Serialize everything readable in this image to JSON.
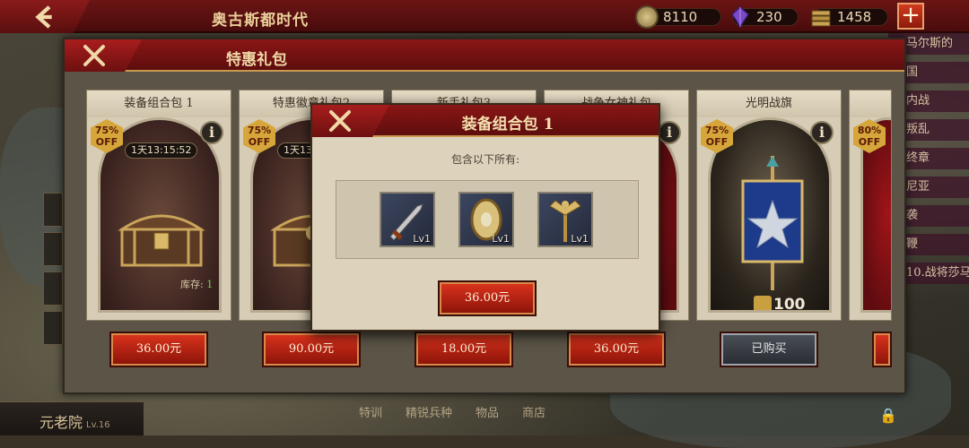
{
  "topbar": {
    "title": "奥古斯都时代",
    "resources": [
      {
        "icon": "coin-icon",
        "value": "8110"
      },
      {
        "icon": "gem-icon",
        "value": "230"
      },
      {
        "icon": "wood-icon",
        "value": "1458"
      }
    ],
    "plus_label": "+"
  },
  "side_list": [
    "马尔斯的",
    "国",
    "内战",
    "叛乱",
    "终章",
    "尼亚",
    "袭",
    "鞭",
    "10.战将莎马人"
  ],
  "bottom": {
    "senate_label": "元老院",
    "senate_level": "Lv.16",
    "tabs": [
      "特训",
      "精锐兵种",
      "物品",
      "商店"
    ]
  },
  "panel": {
    "title": "特惠礼包",
    "cards": [
      {
        "title": "装备组合包 1",
        "off": "75%\nOFF",
        "timer": "1天13:15:52",
        "stock_label": "库存:",
        "stock_value": "1",
        "price": "36.00元"
      },
      {
        "title": "特惠徽章礼包2",
        "off": "75%\nOFF",
        "timer": "1天13:15:52",
        "price": "90.00元"
      },
      {
        "title": "新手礼包3",
        "price": "18.00元"
      },
      {
        "title": "战争女神礼包",
        "price": "36.00元"
      },
      {
        "title": "光明战旗",
        "off": "75%\nOFF",
        "quantity": "100",
        "price": "已购买"
      },
      {
        "title": "",
        "off": "80%\nOFF",
        "price": ""
      }
    ]
  },
  "modal": {
    "title": "装备组合包 1",
    "subtitle": "包含以下所有:",
    "items": [
      {
        "icon": "dagger-icon",
        "level": "Lv1"
      },
      {
        "icon": "shield-icon",
        "level": "Lv1"
      },
      {
        "icon": "eagle-standard-icon",
        "level": "Lv1"
      }
    ],
    "buy_label": "36.00元"
  },
  "colors": {
    "header_red": "#7a1212",
    "gold_trim": "#c99a50",
    "button_red": "#c0281a",
    "panel_parchment": "#ddd3bd"
  }
}
